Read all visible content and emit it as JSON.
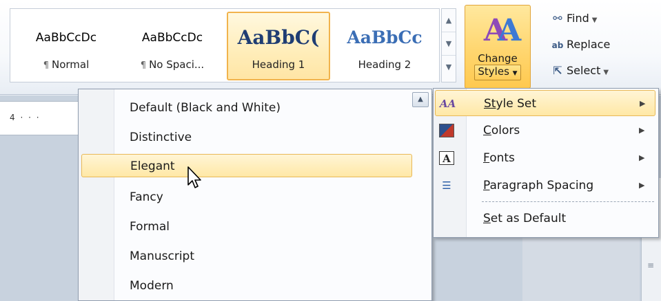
{
  "ribbon": {
    "style_gallery": [
      {
        "preview": "AaBbCcDc",
        "label": "Normal",
        "selected": false
      },
      {
        "preview": "AaBbCcDc",
        "label": "No Spaci...",
        "selected": false
      },
      {
        "preview": "AaBbC(",
        "label": "Heading 1",
        "selected": true
      },
      {
        "preview": "AaBbCc",
        "label": "Heading 2",
        "selected": false
      }
    ],
    "para_mark": "¶",
    "change_styles": {
      "line1": "Change",
      "line2": "Styles",
      "icon": "change-styles-icon"
    },
    "editing": [
      {
        "label": "Find",
        "icon": "binoculars-icon",
        "has_dropdown": true
      },
      {
        "label": "Replace",
        "icon": "replace-icon",
        "has_dropdown": false
      },
      {
        "label": "Select",
        "icon": "cursor-select-icon",
        "has_dropdown": true
      }
    ]
  },
  "ruler": {
    "text": "4 · · ·"
  },
  "style_set_menu": {
    "items": [
      {
        "label": "Default (Black and White)",
        "highlight": false
      },
      {
        "label": "Distinctive",
        "highlight": false
      },
      {
        "label": "Elegant",
        "highlight": true
      },
      {
        "label": "Fancy",
        "highlight": false
      },
      {
        "label": "Formal",
        "highlight": false
      },
      {
        "label": "Manuscript",
        "highlight": false
      },
      {
        "label": "Modern",
        "highlight": false
      }
    ]
  },
  "change_styles_menu": {
    "items": [
      {
        "accel": "St",
        "rest": "yle Set",
        "icon": "style-set-icon",
        "submenu": true,
        "highlight": true
      },
      {
        "accel": "C",
        "rest": "olors",
        "icon": "colors-icon",
        "submenu": true,
        "highlight": false
      },
      {
        "accel": "F",
        "rest": "onts",
        "icon": "fonts-icon",
        "submenu": true,
        "highlight": false
      },
      {
        "accel": "P",
        "rest": "aragraph Spacing",
        "icon": "paragraph-spacing-icon",
        "submenu": true,
        "highlight": false
      },
      {
        "accel": "S",
        "rest": "et as Default",
        "icon": "",
        "submenu": false,
        "highlight": false
      }
    ]
  },
  "colors": {
    "accent_highlight": "#ffe8a6",
    "highlight_border": "#e8b856",
    "heading1": "#1f3d73",
    "heading2": "#3b6eb5"
  }
}
